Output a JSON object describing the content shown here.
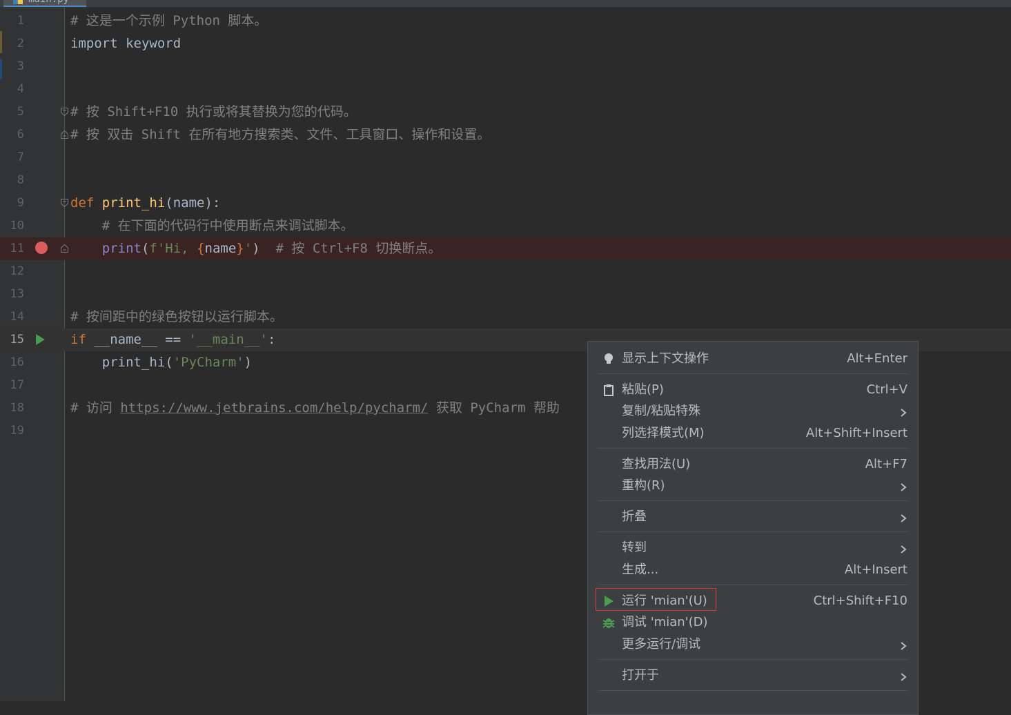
{
  "editor": {
    "tab_title": "main.py",
    "lines": [
      {
        "n": "1",
        "tokens": [
          {
            "t": "# 这是一个示例 Python 脚本。",
            "c": "comment"
          }
        ]
      },
      {
        "n": "2",
        "tokens": [
          {
            "t": "import",
            "c": "kw-plain"
          },
          {
            "t": " keyword",
            "c": "plain"
          }
        ]
      },
      {
        "n": "3",
        "tokens": []
      },
      {
        "n": "4",
        "tokens": []
      },
      {
        "n": "5",
        "tokens": [
          {
            "t": "# 按 Shift+F10 执行或将其替换为您的代码。",
            "c": "comment"
          }
        ]
      },
      {
        "n": "6",
        "tokens": [
          {
            "t": "# 按 双击 Shift 在所有地方搜索类、文件、工具窗口、操作和设置。",
            "c": "comment"
          }
        ]
      },
      {
        "n": "7",
        "tokens": []
      },
      {
        "n": "8",
        "tokens": []
      },
      {
        "n": "9",
        "tokens": [
          {
            "t": "def",
            "c": "kw"
          },
          {
            "t": " ",
            "c": "plain"
          },
          {
            "t": "print_hi",
            "c": "fn"
          },
          {
            "t": "(name):",
            "c": "plain"
          }
        ]
      },
      {
        "n": "10",
        "tokens": [
          {
            "t": "    # 在下面的代码行中使用断点来调试脚本。",
            "c": "comment"
          }
        ]
      },
      {
        "n": "11",
        "tokens": [
          {
            "t": "    ",
            "c": "plain"
          },
          {
            "t": "print",
            "c": "builtin"
          },
          {
            "t": "(",
            "c": "plain"
          },
          {
            "t": "f'Hi, ",
            "c": "str"
          },
          {
            "t": "{",
            "c": "kw"
          },
          {
            "t": "name",
            "c": "plain"
          },
          {
            "t": "}",
            "c": "kw"
          },
          {
            "t": "'",
            "c": "str"
          },
          {
            "t": ")  ",
            "c": "plain"
          },
          {
            "t": "# 按 Ctrl+F8 切换断点。",
            "c": "comment"
          }
        ]
      },
      {
        "n": "12",
        "tokens": []
      },
      {
        "n": "13",
        "tokens": []
      },
      {
        "n": "14",
        "tokens": [
          {
            "t": "# 按间距中的绿色按钮以运行脚本。",
            "c": "comment"
          }
        ]
      },
      {
        "n": "15",
        "tokens": [
          {
            "t": "if",
            "c": "kw"
          },
          {
            "t": " __name__ == ",
            "c": "plain"
          },
          {
            "t": "'__main__'",
            "c": "str"
          },
          {
            "t": ":",
            "c": "plain"
          }
        ]
      },
      {
        "n": "16",
        "tokens": [
          {
            "t": "    print_hi(",
            "c": "plain"
          },
          {
            "t": "'PyCharm'",
            "c": "str"
          },
          {
            "t": ")",
            "c": "plain"
          }
        ]
      },
      {
        "n": "17",
        "tokens": []
      },
      {
        "n": "18",
        "tokens": [
          {
            "t": "# 访问 ",
            "c": "comment"
          },
          {
            "t": "https://www.jetbrains.com/help/pycharm/",
            "c": "url"
          },
          {
            "t": " 获取 PyCharm 帮助",
            "c": "comment"
          }
        ]
      },
      {
        "n": "19",
        "tokens": []
      }
    ]
  },
  "context_menu": {
    "items": [
      {
        "label": "显示上下文操作",
        "shortcut": "Alt+Enter",
        "icon": "lightbulb-icon"
      },
      {
        "label": "粘贴(P)",
        "shortcut": "Ctrl+V",
        "icon": "clipboard-icon"
      },
      {
        "label": "复制/粘贴特殊",
        "shortcut": "",
        "submenu": true
      },
      {
        "label": "列选择模式(M)",
        "shortcut": "Alt+Shift+Insert"
      },
      {
        "label": "查找用法(U)",
        "shortcut": "Alt+F7"
      },
      {
        "label": "重构(R)",
        "shortcut": "",
        "submenu": true
      },
      {
        "label": "折叠",
        "shortcut": "",
        "submenu": true
      },
      {
        "label": "转到",
        "shortcut": "",
        "submenu": true
      },
      {
        "label": "生成...",
        "shortcut": "Alt+Insert"
      },
      {
        "label": "运行 'mian'(U)",
        "shortcut": "Ctrl+Shift+F10",
        "icon": "run-icon",
        "highlighted": true
      },
      {
        "label": "调试 'mian'(D)",
        "shortcut": "",
        "icon": "debug-bug-icon"
      },
      {
        "label": "更多运行/调试",
        "shortcut": "",
        "submenu": true
      },
      {
        "label": "打开于",
        "shortcut": "",
        "submenu": true
      }
    ]
  },
  "colors": {
    "background": "#2b2b2b",
    "comment": "#808080",
    "keyword": "#cc7832",
    "function": "#ffc66d",
    "string": "#6a8759",
    "builtin": "#8888c6",
    "breakpoint": "#db5c5c",
    "run_green": "#499c54",
    "highlight_border": "#d93a3a"
  }
}
